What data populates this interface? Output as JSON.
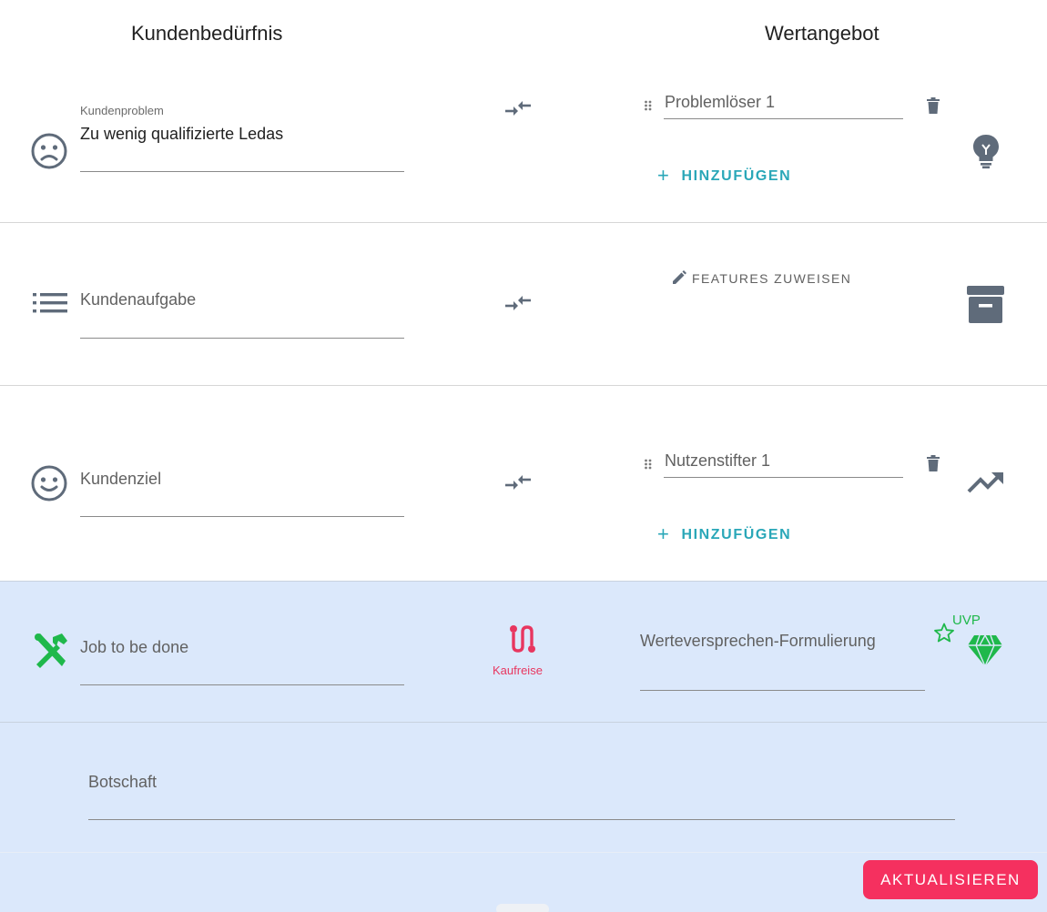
{
  "header": {
    "left_title": "Kundenbedürfnis",
    "right_title": "Wertangebot"
  },
  "rows": {
    "problem": {
      "field_label": "Kundenproblem",
      "field_value": "Zu wenig qualifizierte Ledas",
      "solver_item_value": "Problemlöser 1",
      "add_label": "HINZUFÜGEN",
      "left_icon": "sad-face-icon",
      "right_icon": "lightbulb-icon"
    },
    "task": {
      "field_placeholder": "Kundenaufgabe",
      "features_label": "FEATURES ZUWEISEN",
      "left_icon": "list-icon",
      "right_icon": "archive-box-icon"
    },
    "goal": {
      "field_placeholder": "Kundenziel",
      "benefit_item_value": "Nutzenstifter 1",
      "add_label": "HINZUFÜGEN",
      "left_icon": "smile-face-icon",
      "right_icon": "trending-up-icon"
    },
    "job": {
      "field_placeholder": "Job to be done",
      "journey_label": "Kaufreise",
      "value_prop_placeholder": "Werteversprechen-Formulierung",
      "uvp_label": "UVP",
      "left_icon": "tools-icon",
      "right_icon": "diamond-icon"
    },
    "message": {
      "field_placeholder": "Botschaft"
    }
  },
  "actions": {
    "submit_label": "AKTUALISIEREN"
  },
  "colors": {
    "accent_teal": "#2aa7b8",
    "primary_pink": "#f5305f",
    "green": "#1fb84b",
    "icon_slate": "#5f6b7a",
    "highlight_bg": "#dbe8fb"
  }
}
